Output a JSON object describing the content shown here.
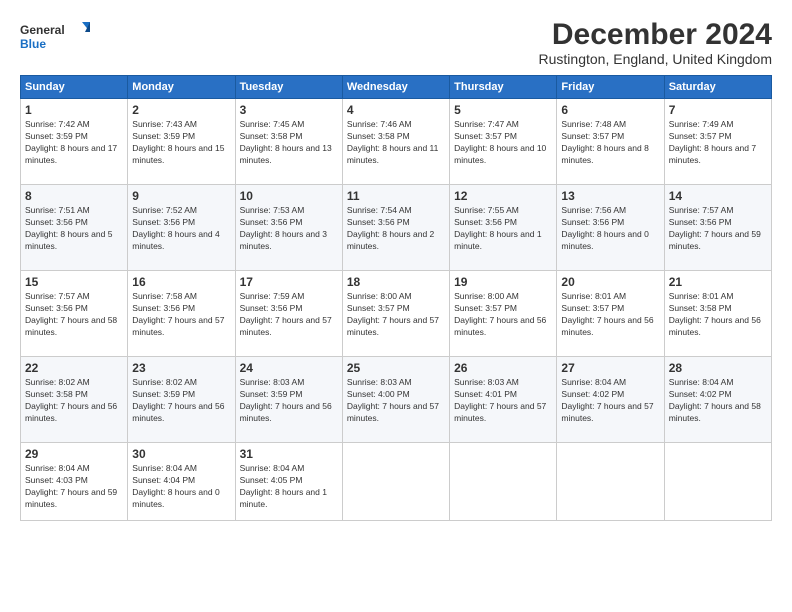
{
  "logo": {
    "line1": "General",
    "line2": "Blue"
  },
  "title": "December 2024",
  "subtitle": "Rustington, England, United Kingdom",
  "weekdays": [
    "Sunday",
    "Monday",
    "Tuesday",
    "Wednesday",
    "Thursday",
    "Friday",
    "Saturday"
  ],
  "weeks": [
    [
      {
        "day": "1",
        "sunrise": "7:42 AM",
        "sunset": "3:59 PM",
        "daylight": "8 hours and 17 minutes."
      },
      {
        "day": "2",
        "sunrise": "7:43 AM",
        "sunset": "3:59 PM",
        "daylight": "8 hours and 15 minutes."
      },
      {
        "day": "3",
        "sunrise": "7:45 AM",
        "sunset": "3:58 PM",
        "daylight": "8 hours and 13 minutes."
      },
      {
        "day": "4",
        "sunrise": "7:46 AM",
        "sunset": "3:58 PM",
        "daylight": "8 hours and 11 minutes."
      },
      {
        "day": "5",
        "sunrise": "7:47 AM",
        "sunset": "3:57 PM",
        "daylight": "8 hours and 10 minutes."
      },
      {
        "day": "6",
        "sunrise": "7:48 AM",
        "sunset": "3:57 PM",
        "daylight": "8 hours and 8 minutes."
      },
      {
        "day": "7",
        "sunrise": "7:49 AM",
        "sunset": "3:57 PM",
        "daylight": "8 hours and 7 minutes."
      }
    ],
    [
      {
        "day": "8",
        "sunrise": "7:51 AM",
        "sunset": "3:56 PM",
        "daylight": "8 hours and 5 minutes."
      },
      {
        "day": "9",
        "sunrise": "7:52 AM",
        "sunset": "3:56 PM",
        "daylight": "8 hours and 4 minutes."
      },
      {
        "day": "10",
        "sunrise": "7:53 AM",
        "sunset": "3:56 PM",
        "daylight": "8 hours and 3 minutes."
      },
      {
        "day": "11",
        "sunrise": "7:54 AM",
        "sunset": "3:56 PM",
        "daylight": "8 hours and 2 minutes."
      },
      {
        "day": "12",
        "sunrise": "7:55 AM",
        "sunset": "3:56 PM",
        "daylight": "8 hours and 1 minute."
      },
      {
        "day": "13",
        "sunrise": "7:56 AM",
        "sunset": "3:56 PM",
        "daylight": "8 hours and 0 minutes."
      },
      {
        "day": "14",
        "sunrise": "7:57 AM",
        "sunset": "3:56 PM",
        "daylight": "7 hours and 59 minutes."
      }
    ],
    [
      {
        "day": "15",
        "sunrise": "7:57 AM",
        "sunset": "3:56 PM",
        "daylight": "7 hours and 58 minutes."
      },
      {
        "day": "16",
        "sunrise": "7:58 AM",
        "sunset": "3:56 PM",
        "daylight": "7 hours and 57 minutes."
      },
      {
        "day": "17",
        "sunrise": "7:59 AM",
        "sunset": "3:56 PM",
        "daylight": "7 hours and 57 minutes."
      },
      {
        "day": "18",
        "sunrise": "8:00 AM",
        "sunset": "3:57 PM",
        "daylight": "7 hours and 57 minutes."
      },
      {
        "day": "19",
        "sunrise": "8:00 AM",
        "sunset": "3:57 PM",
        "daylight": "7 hours and 56 minutes."
      },
      {
        "day": "20",
        "sunrise": "8:01 AM",
        "sunset": "3:57 PM",
        "daylight": "7 hours and 56 minutes."
      },
      {
        "day": "21",
        "sunrise": "8:01 AM",
        "sunset": "3:58 PM",
        "daylight": "7 hours and 56 minutes."
      }
    ],
    [
      {
        "day": "22",
        "sunrise": "8:02 AM",
        "sunset": "3:58 PM",
        "daylight": "7 hours and 56 minutes."
      },
      {
        "day": "23",
        "sunrise": "8:02 AM",
        "sunset": "3:59 PM",
        "daylight": "7 hours and 56 minutes."
      },
      {
        "day": "24",
        "sunrise": "8:03 AM",
        "sunset": "3:59 PM",
        "daylight": "7 hours and 56 minutes."
      },
      {
        "day": "25",
        "sunrise": "8:03 AM",
        "sunset": "4:00 PM",
        "daylight": "7 hours and 57 minutes."
      },
      {
        "day": "26",
        "sunrise": "8:03 AM",
        "sunset": "4:01 PM",
        "daylight": "7 hours and 57 minutes."
      },
      {
        "day": "27",
        "sunrise": "8:04 AM",
        "sunset": "4:02 PM",
        "daylight": "7 hours and 57 minutes."
      },
      {
        "day": "28",
        "sunrise": "8:04 AM",
        "sunset": "4:02 PM",
        "daylight": "7 hours and 58 minutes."
      }
    ],
    [
      {
        "day": "29",
        "sunrise": "8:04 AM",
        "sunset": "4:03 PM",
        "daylight": "7 hours and 59 minutes."
      },
      {
        "day": "30",
        "sunrise": "8:04 AM",
        "sunset": "4:04 PM",
        "daylight": "8 hours and 0 minutes."
      },
      {
        "day": "31",
        "sunrise": "8:04 AM",
        "sunset": "4:05 PM",
        "daylight": "8 hours and 1 minute."
      },
      null,
      null,
      null,
      null
    ]
  ],
  "labels": {
    "sunrise": "Sunrise:",
    "sunset": "Sunset:",
    "daylight": "Daylight:"
  }
}
